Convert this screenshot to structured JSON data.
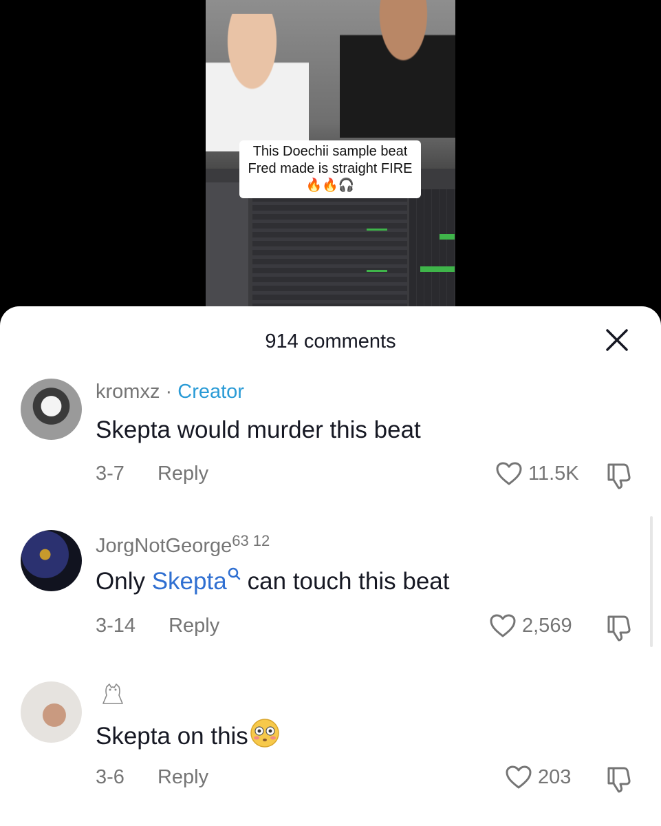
{
  "video": {
    "caption_line1": "This Doechii sample beat",
    "caption_line2": "Fred made is straight FIRE",
    "caption_emoji": "🔥🔥🎧"
  },
  "sheet": {
    "title": "914 comments",
    "close_icon": "close-icon"
  },
  "comments": [
    {
      "username": "kromxz",
      "separator": "·",
      "badge": "Creator",
      "text": "Skepta would murder this beat",
      "date": "3-7",
      "reply_label": "Reply",
      "likes": "11.5K"
    },
    {
      "username": "JorgNotGeorge",
      "superscript_1": "63",
      "superscript_2": "12",
      "text_before": "Only ",
      "text_link": "Skepta",
      "text_after": "can touch this beat",
      "date": "3-14",
      "reply_label": "Reply",
      "likes": "2,569"
    },
    {
      "username_icon": "owl-icon",
      "text": "Skepta on this",
      "emoji": "😳",
      "date": "3-6",
      "reply_label": "Reply",
      "likes": "203"
    }
  ],
  "colors": {
    "creator_badge": "#2a9bd6",
    "link": "#2f6fd1",
    "meta_gray": "#757575",
    "text_dark": "#161823"
  }
}
